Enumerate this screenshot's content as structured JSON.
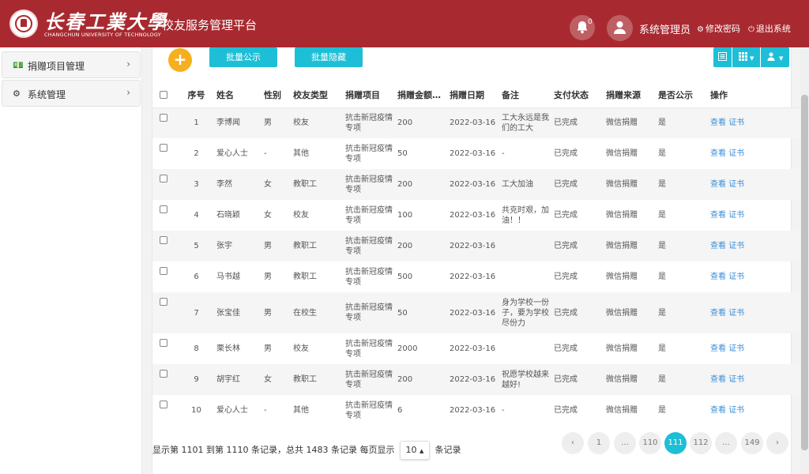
{
  "header": {
    "brand_cn": "长春工業大學",
    "brand_en": "CHANGCHUN UNIVERSITY OF TECHNOLOGY",
    "platform_title": "校友服务管理平台",
    "notification_count": "0",
    "username": "系统管理员",
    "change_password": "修改密码",
    "logout": "退出系统",
    "colors": {
      "header_bg": "#a82a30",
      "accent": "#1ebfd6",
      "add": "#f6b01e"
    }
  },
  "sidebar": {
    "items": [
      {
        "label": "捐赠项目管理",
        "icon": "money-icon"
      },
      {
        "label": "系统管理",
        "icon": "gears-icon"
      }
    ]
  },
  "toolbar": {
    "batch_publish": "批量公示",
    "batch_hide": "批量隐藏"
  },
  "table": {
    "columns": [
      "序号",
      "姓名",
      "性别",
      "校友类型",
      "捐赠项目",
      "捐赠金额…",
      "捐赠日期",
      "备注",
      "支付状态",
      "捐赠来源",
      "是否公示",
      "操作"
    ],
    "rows": [
      {
        "no": "1",
        "name": "李博闻",
        "gender": "男",
        "type": "校友",
        "project": "抗击新冠疫情专项",
        "amount": "200",
        "date": "2022-03-16",
        "note": "工大永远是我们的工大",
        "status": "已完成",
        "source": "微信捐赠",
        "public": "是",
        "view": "查看",
        "cert": "证书"
      },
      {
        "no": "2",
        "name": "爱心人士",
        "gender": "-",
        "type": "其他",
        "project": "抗击新冠疫情专项",
        "amount": "50",
        "date": "2022-03-16",
        "note": "-",
        "status": "已完成",
        "source": "微信捐赠",
        "public": "是",
        "view": "查看",
        "cert": "证书"
      },
      {
        "no": "3",
        "name": "李然",
        "gender": "女",
        "type": "教职工",
        "project": "抗击新冠疫情专项",
        "amount": "200",
        "date": "2022-03-16",
        "note": "工大加油",
        "status": "已完成",
        "source": "微信捐赠",
        "public": "是",
        "view": "查看",
        "cert": "证书"
      },
      {
        "no": "4",
        "name": "石晓颖",
        "gender": "女",
        "type": "校友",
        "project": "抗击新冠疫情专项",
        "amount": "100",
        "date": "2022-03-16",
        "note": "共克时艰，加油！！",
        "status": "已完成",
        "source": "微信捐赠",
        "public": "是",
        "view": "查看",
        "cert": "证书"
      },
      {
        "no": "5",
        "name": "张宇",
        "gender": "男",
        "type": "教职工",
        "project": "抗击新冠疫情专项",
        "amount": "200",
        "date": "2022-03-16",
        "note": "",
        "status": "已完成",
        "source": "微信捐赠",
        "public": "是",
        "view": "查看",
        "cert": "证书"
      },
      {
        "no": "6",
        "name": "马书越",
        "gender": "男",
        "type": "教职工",
        "project": "抗击新冠疫情专项",
        "amount": "500",
        "date": "2022-03-16",
        "note": "",
        "status": "已完成",
        "source": "微信捐赠",
        "public": "是",
        "view": "查看",
        "cert": "证书"
      },
      {
        "no": "7",
        "name": "张宝佳",
        "gender": "男",
        "type": "在校生",
        "project": "抗击新冠疫情专项",
        "amount": "50",
        "date": "2022-03-16",
        "note": "身为学校一份子，要为学校尽份力",
        "status": "已完成",
        "source": "微信捐赠",
        "public": "是",
        "view": "查看",
        "cert": "证书"
      },
      {
        "no": "8",
        "name": "栗长林",
        "gender": "男",
        "type": "校友",
        "project": "抗击新冠疫情专项",
        "amount": "2000",
        "date": "2022-03-16",
        "note": "",
        "status": "已完成",
        "source": "微信捐赠",
        "public": "是",
        "view": "查看",
        "cert": "证书"
      },
      {
        "no": "9",
        "name": "胡宇红",
        "gender": "女",
        "type": "教职工",
        "project": "抗击新冠疫情专项",
        "amount": "200",
        "date": "2022-03-16",
        "note": "祝愿学校越来越好!",
        "status": "已完成",
        "source": "微信捐赠",
        "public": "是",
        "view": "查看",
        "cert": "证书"
      },
      {
        "no": "10",
        "name": "爱心人士",
        "gender": "-",
        "type": "其他",
        "project": "抗击新冠疫情专项",
        "amount": "6",
        "date": "2022-03-16",
        "note": "-",
        "status": "已完成",
        "source": "微信捐赠",
        "public": "是",
        "view": "查看",
        "cert": "证书"
      }
    ]
  },
  "pagination": {
    "info_prefix": "显示第 1101 到第 1110 条记录，总共 1483 条记录 每页显示",
    "page_size": "10",
    "info_suffix": "条记录",
    "pages": [
      "‹",
      "1",
      "...",
      "110",
      "111",
      "112",
      "...",
      "149",
      "›"
    ],
    "active": "111"
  }
}
